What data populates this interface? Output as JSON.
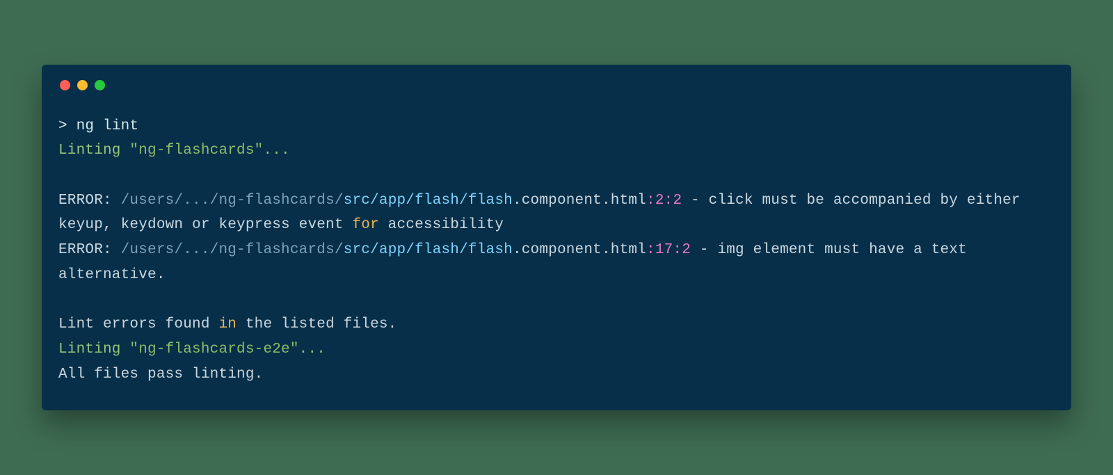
{
  "prompt": "> ",
  "command": "ng lint",
  "lint1": {
    "prefix": "Linting ",
    "project": "\"ng-flashcards\"",
    "suffix": "..."
  },
  "err1": {
    "label": "ERROR: ",
    "path_dim": "/users/.../ng-flashcards/",
    "path_bright": "src/app/flash/flash",
    "dot1": ".",
    "component": "component",
    "dot2": ".",
    "ext": "html",
    "colon": ":",
    "line": "2",
    "col": "2",
    "dash": " - ",
    "msg_a": "click must be accompanied by either keyup, keydown or keypress event ",
    "msg_for": "for",
    "msg_b": " accessibility"
  },
  "err2": {
    "label": "ERROR: ",
    "path_dim": "/users/.../ng-flashcards/",
    "path_bright": "src/app/flash/flash",
    "dot1": ".",
    "component": "component",
    "dot2": ".",
    "ext": "html",
    "colon": ":",
    "line": "17",
    "col": "2",
    "dash": " - ",
    "msg": "img element must have a text alternative."
  },
  "summary": {
    "a": "Lint errors found ",
    "in": "in",
    "b": " the listed files."
  },
  "lint2": {
    "prefix": "Linting ",
    "project": "\"ng-flashcards-e2e\"",
    "suffix": "..."
  },
  "pass": "All files pass linting."
}
